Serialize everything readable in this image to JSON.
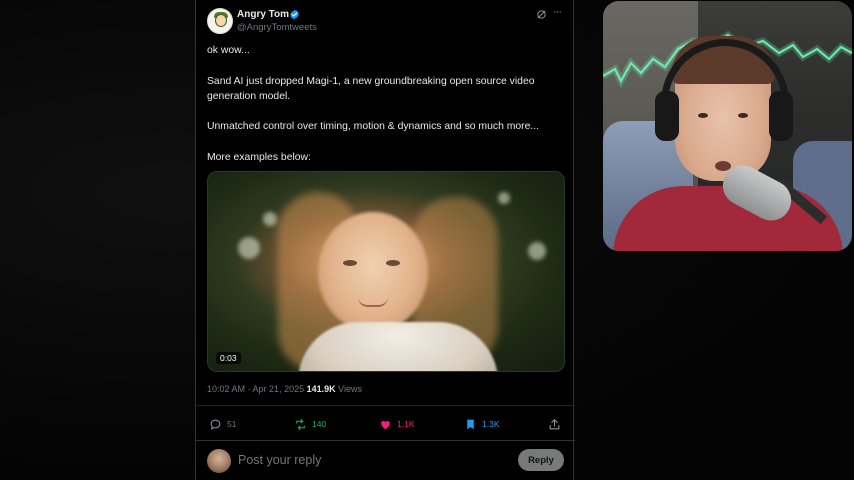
{
  "tweet": {
    "author_name": "Angry Tom",
    "author_handle": "@AngryTomtweets",
    "lines": [
      "ok wow...",
      "Sand AI just dropped Magi-1, a new groundbreaking open source video",
      "generation model.",
      "Unmatched control over timing, motion & dynamics and so much more...",
      "More examples below:"
    ],
    "media": {
      "duration": "0:03"
    },
    "meta": {
      "time": "10:02 AM",
      "separator": " · ",
      "date": "Apr 21, 2025",
      "views_count": "141.9K",
      "views_label": " Views"
    },
    "actions": {
      "replies": "51",
      "reposts": "140",
      "likes": "1.1K",
      "bookmarks": "1.3K"
    },
    "reply": {
      "placeholder": "Post your reply",
      "button_label": "Reply"
    }
  },
  "icons": {
    "verified": "verified-badge-icon",
    "grok": "grok-icon",
    "more": "more-icon",
    "reply": "reply-icon",
    "repost": "repost-icon",
    "like": "like-icon",
    "bookmark": "bookmark-icon",
    "share": "share-icon"
  },
  "colors": {
    "background": "#000000",
    "text_primary": "#e7e9ea",
    "text_secondary": "#71767b",
    "verified_blue": "#1d9bf0",
    "repost_green": "#00ba7c",
    "like_pink": "#f91880",
    "bookmark_blue": "#1d9bf0",
    "webcam_neon": "#6ef5b5"
  }
}
